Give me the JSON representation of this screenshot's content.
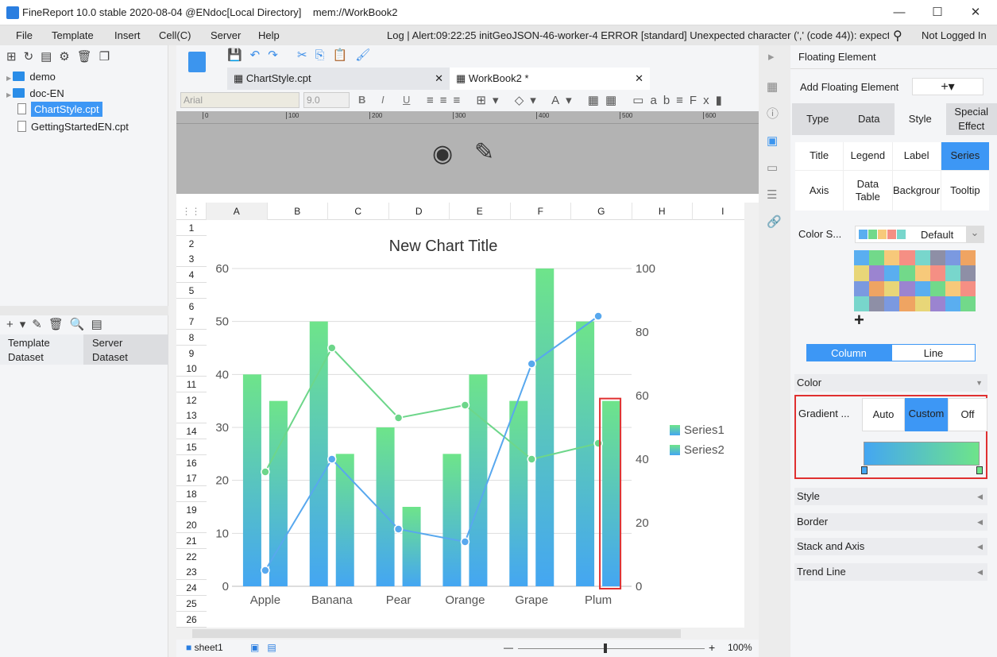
{
  "window": {
    "title": "FineReport 10.0 stable 2020-08-04 @ENdoc[Local Directory]    mem://WorkBook2",
    "minimize": "—",
    "maximize": "☐",
    "close": "✕"
  },
  "menu": {
    "items": [
      "File",
      "Template",
      "Insert",
      "Cell(C)",
      "Server",
      "Help"
    ],
    "log": "Log | Alert:09:22:25 initGeoJSON-46-worker-4 ERROR [standard] Unexpected character (',' (code 44)): expect...",
    "login": "Not Logged In"
  },
  "tree": {
    "items": [
      {
        "label": "demo",
        "type": "folder"
      },
      {
        "label": "doc-EN",
        "type": "folder"
      },
      {
        "label": "ChartStyle.cpt",
        "type": "file",
        "selected": true
      },
      {
        "label": "GettingStartedEN.cpt",
        "type": "file"
      }
    ]
  },
  "dataset": {
    "tabs": [
      "Template Dataset",
      "Server Dataset"
    ]
  },
  "tabs": [
    {
      "label": "ChartStyle.cpt"
    },
    {
      "label": "WorkBook2 *",
      "active": true
    }
  ],
  "format": {
    "font": "Arial",
    "size": "9.0",
    "bold": "B",
    "italic": "I",
    "underline": "U"
  },
  "ruler": [
    "0",
    "100",
    "200",
    "300",
    "400",
    "500",
    "600"
  ],
  "columns": [
    "A",
    "B",
    "C",
    "D",
    "E",
    "F",
    "G",
    "H",
    "I"
  ],
  "rows": [
    "1",
    "2",
    "3",
    "4",
    "5",
    "6",
    "7",
    "8",
    "9",
    "10",
    "11",
    "12",
    "13",
    "14",
    "15",
    "16",
    "17",
    "18",
    "19",
    "20",
    "21",
    "22",
    "23",
    "24",
    "25",
    "26"
  ],
  "sheet": {
    "tab": "sheet1",
    "zoom": "100%",
    "minus": "—",
    "plus": "+"
  },
  "chart_data": {
    "type": "bar",
    "title": "New Chart Title",
    "categories": [
      "Apple",
      "Banana",
      "Pear",
      "Orange",
      "Grape",
      "Plum"
    ],
    "ylim": [
      0,
      60
    ],
    "yticks": [
      "0",
      "10",
      "20",
      "30",
      "40",
      "50",
      "60"
    ],
    "y2lim": [
      0,
      100
    ],
    "y2ticks": [
      "0",
      "20",
      "40",
      "60",
      "80",
      "100"
    ],
    "grid": true,
    "legend": "right",
    "series": [
      {
        "name": "Series1",
        "type": "bar",
        "values": [
          40,
          50,
          30,
          25,
          35,
          50
        ]
      },
      {
        "name": "Series2",
        "type": "bar",
        "values": [
          35,
          25,
          15,
          40,
          60,
          35
        ]
      },
      {
        "type": "line",
        "axis": "right",
        "color": "#6dd68a",
        "values": [
          36,
          75,
          53,
          57,
          40,
          45
        ]
      },
      {
        "type": "line",
        "axis": "right",
        "color": "#58a8ee",
        "values": [
          5,
          40,
          18,
          14,
          70,
          85
        ]
      }
    ],
    "gradient": [
      "#6ee48a",
      "#44a6f2"
    ],
    "highlight": "#e03030"
  },
  "panel": {
    "title": "Floating Element",
    "add_label": "Add Floating Element",
    "add_button": "+▾",
    "tabs": [
      "Type",
      "Data",
      "Style",
      "Special Effect"
    ],
    "active_tab": "Style",
    "subtabs": [
      "Title",
      "Legend",
      "Label",
      "Series",
      "Axis",
      "Data Table",
      "Backgrour",
      "Tooltip"
    ],
    "active_subtab": "Series",
    "color_scheme_label": "Color S...",
    "color_scheme_value": "Default",
    "palette": [
      "#5aaef0",
      "#72d98a",
      "#f7c97a",
      "#f58f84",
      "#78d6cc",
      "#8e8fa6",
      "#7b99e0",
      "#efa462",
      "#e8d678",
      "#9b84d0",
      "#5aaef0",
      "#72d98a",
      "#f7c97a",
      "#f58f84",
      "#78d6cc",
      "#8e8fa6",
      "#7b99e0",
      "#efa462",
      "#e8d678",
      "#9b84d0",
      "#5aaef0",
      "#72d98a",
      "#f7c97a",
      "#f58f84",
      "#78d6cc",
      "#8e8fa6",
      "#7b99e0",
      "#efa462",
      "#e8d678",
      "#9b84d0",
      "#5aaef0",
      "#72d98a"
    ],
    "add_color": "+",
    "type_toggle": [
      "Column",
      "Line"
    ],
    "color_section": "Color",
    "gradient_label": "Gradient ...",
    "gradient_options": [
      "Auto",
      "Custom",
      "Off"
    ],
    "gradient_active": "Custom",
    "sections": [
      "Style",
      "Border",
      "Stack and Axis",
      "Trend Line"
    ]
  }
}
